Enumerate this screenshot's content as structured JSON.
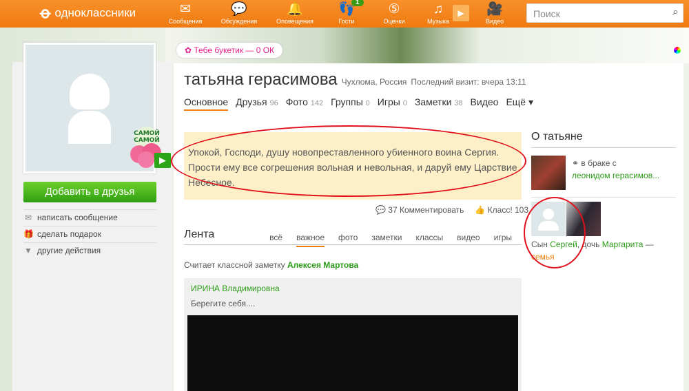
{
  "header": {
    "logo": "одноклассники",
    "nav": [
      {
        "label": "Сообщения",
        "icon": "envelope-icon"
      },
      {
        "label": "Обсуждения",
        "icon": "chat-bubbles-icon"
      },
      {
        "label": "Оповещения",
        "icon": "bell-icon"
      },
      {
        "label": "Гости",
        "icon": "footprints-icon",
        "badge": "1"
      },
      {
        "label": "Оценки",
        "icon": "rating-5-icon"
      },
      {
        "label": "Музыка",
        "icon": "music-note-icon"
      },
      {
        "label": "Видео",
        "icon": "video-camera-icon"
      }
    ],
    "search_placeholder": "Поиск"
  },
  "banner": {
    "bouquet": "Тебе букетик — 0 ОК"
  },
  "sidebar": {
    "sticker": "САМОЙ-САМОЙ",
    "add_friend": "Добавить в друзья",
    "actions": [
      "написать сообщение",
      "сделать подарок",
      "другие действия"
    ]
  },
  "profile": {
    "name": "татьяна герасимова",
    "location": "Чухлома, Россия",
    "last_visit": "Последний визит: вчера 13:11",
    "tabs": [
      {
        "label": "Основное",
        "count": ""
      },
      {
        "label": "Друзья",
        "count": "96"
      },
      {
        "label": "Фото",
        "count": "142"
      },
      {
        "label": "Группы",
        "count": "0"
      },
      {
        "label": "Игры",
        "count": "0"
      },
      {
        "label": "Заметки",
        "count": "38"
      },
      {
        "label": "Видео",
        "count": ""
      },
      {
        "label": "Ещё ▾",
        "count": ""
      }
    ]
  },
  "status": {
    "text": "Упокой, Господи, душу новопреставленного убиенного воина Сергия. Прости ему все согрешения вольная и невольная, и даруй ему Царствие Небесное.",
    "comments": "37 Комментировать",
    "likes": "Класс! 103"
  },
  "feed": {
    "title": "Лента",
    "tabs": [
      "всё",
      "важное",
      "фото",
      "заметки",
      "классы",
      "видео",
      "игры"
    ],
    "active": "важное",
    "liked_prefix": "Считает классной заметку",
    "liked_author": "Алексея Мартова",
    "post": {
      "author": "ИРИНА Владимировна",
      "text": "Берегите себя...."
    }
  },
  "about": {
    "title": "О татьяне",
    "married_prefix": "в браке с",
    "spouse": "леонидом герасимов...",
    "family": {
      "son_prefix": "Сын",
      "son": "Сергей",
      "daughter_prefix": ", дочь",
      "daughter": "Маргарита",
      "dash": " —",
      "family_label": "семья"
    }
  },
  "colors": {
    "orange": "#ee7f10",
    "green": "#2a9b16",
    "annotation_red": "#e0101c"
  }
}
